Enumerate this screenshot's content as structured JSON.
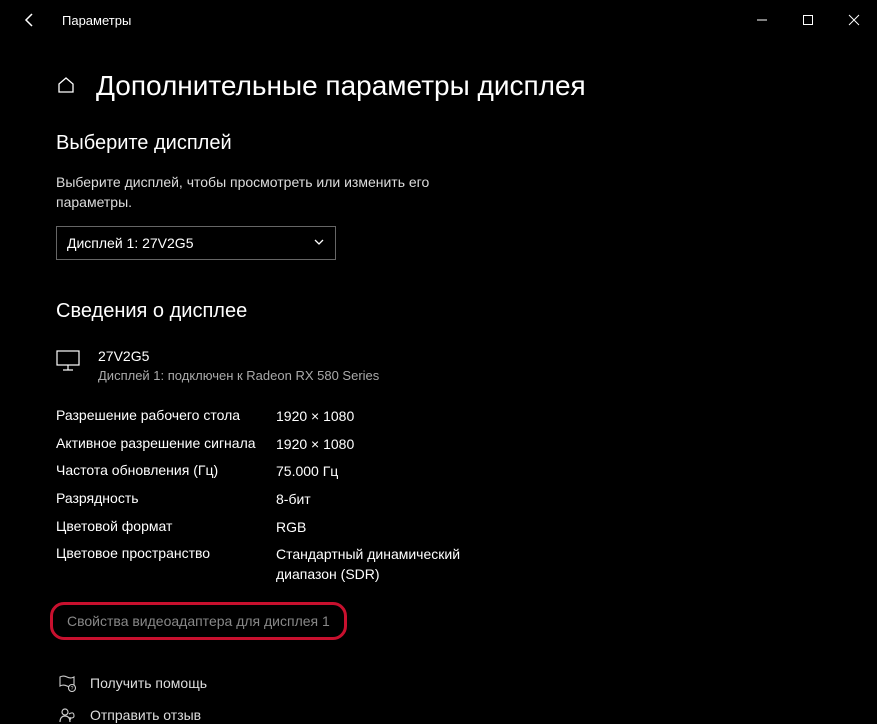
{
  "app_title": "Параметры",
  "page_title": "Дополнительные параметры дисплея",
  "select_section": {
    "title": "Выберите дисплей",
    "desc": "Выберите дисплей, чтобы просмотреть или изменить его параметры.",
    "dropdown_value": "Дисплей 1: 27V2G5"
  },
  "info_section": {
    "title": "Сведения о дисплее",
    "display_name": "27V2G5",
    "display_sub": "Дисплей 1: подключен к Radeon RX 580 Series",
    "props": [
      {
        "label": "Разрешение рабочего стола",
        "value": "1920 × 1080"
      },
      {
        "label": "Активное разрешение сигнала",
        "value": "1920 × 1080"
      },
      {
        "label": "Частота обновления (Гц)",
        "value": "75.000 Гц"
      },
      {
        "label": "Разрядность",
        "value": "8-бит"
      },
      {
        "label": "Цветовой формат",
        "value": "RGB"
      },
      {
        "label": "Цветовое пространство",
        "value": "Стандартный динамический диапазон (SDR)"
      }
    ],
    "adapter_link": "Свойства видеоадаптера для дисплея 1"
  },
  "footer": {
    "help": "Получить помощь",
    "feedback": "Отправить отзыв"
  }
}
